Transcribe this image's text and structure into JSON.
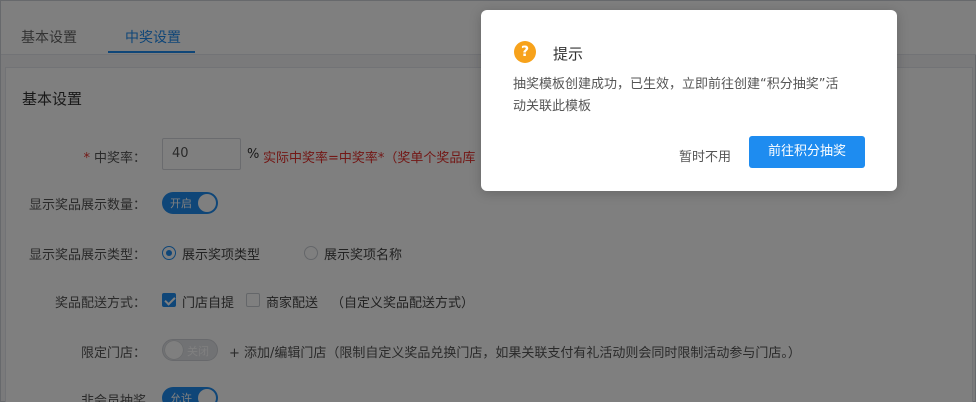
{
  "tabs": [
    {
      "label": "基本设置"
    },
    {
      "label": "中奖设置"
    }
  ],
  "card": {
    "title": "基本设置"
  },
  "form": {
    "win_rate": {
      "label": "中奖率：",
      "value": "40",
      "unit": "%",
      "hint": "实际中奖率=中奖率*（奖单个奖品库"
    },
    "show_count": {
      "label": "显示奖品展示数量：",
      "toggle": "开启"
    },
    "show_type": {
      "label": "显示奖品展示类型：",
      "options": [
        "展示奖项类型",
        "展示奖项名称"
      ],
      "selected": "展示奖项类型"
    },
    "delivery": {
      "label": "奖品配送方式：",
      "options": [
        "门店自提",
        "商家配送"
      ],
      "checked": [
        "门店自提"
      ],
      "note": "（自定义奖品配送方式）"
    },
    "store_limit": {
      "label": "限定门店：",
      "toggle": "关闭",
      "hint": "+ 添加/编辑门店（限制自定义奖品兑换门店，如果关联支付有礼活动则会同时限制活动参与门店。）"
    },
    "non_member": {
      "label": "非会员抽奖",
      "toggle": "允许"
    }
  },
  "dialog": {
    "title": "提示",
    "message": "抽奖模板创建成功，已生效，立即前往创建“积分抽奖”活动关联此模板",
    "cancel_label": "暂时不用",
    "confirm_label": "前往积分抽奖",
    "icon": "question-icon"
  },
  "colors": {
    "primary": "#1e8cf0",
    "warning": "#f7a21b",
    "danger": "#e6302c"
  }
}
